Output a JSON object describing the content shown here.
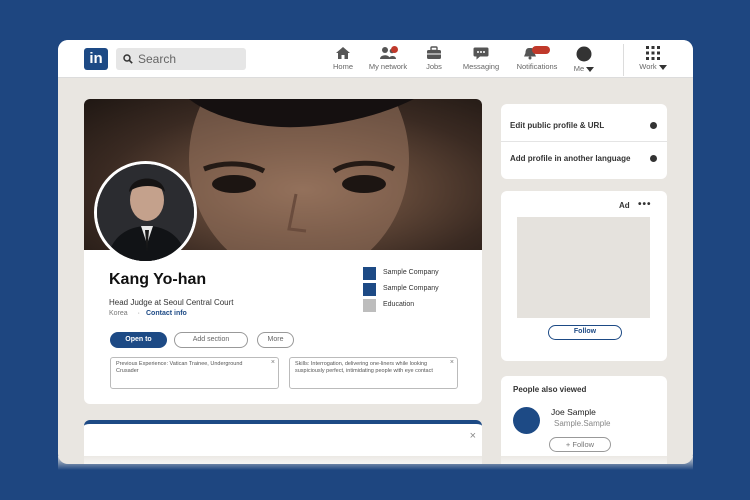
{
  "app": {
    "logo_text": "in",
    "search_placeholder": "Search",
    "accent_color": "#1d4a85",
    "notification_color": "#c0392b"
  },
  "nav": {
    "items": [
      {
        "label": "Home",
        "icon": "home-icon"
      },
      {
        "label": "My network",
        "icon": "network-icon",
        "badge": true
      },
      {
        "label": "Jobs",
        "icon": "briefcase-icon"
      },
      {
        "label": "Messaging",
        "icon": "messaging-icon"
      },
      {
        "label": "Notifications",
        "icon": "bell-icon",
        "badge": true
      },
      {
        "label": "Me",
        "icon": "avatar-icon",
        "dropdown": true
      },
      {
        "label": "Work",
        "icon": "grid-icon",
        "dropdown": true
      }
    ]
  },
  "profile": {
    "name": "Kang Yo-han",
    "headline": "Head Judge at Seoul Central Court",
    "location": "Korea",
    "separator": "·",
    "contact_info": "Contact info",
    "experience": [
      {
        "label": "Sample  Company",
        "color": "#1d4a85"
      },
      {
        "label": "Sample  Company",
        "color": "#1d4a85"
      },
      {
        "label": "Education",
        "color": "#bdbdbd"
      }
    ],
    "actions": {
      "open_to": "Open to",
      "add_section": "Add section",
      "more": "More"
    },
    "info_boxes": [
      {
        "text": "Previous Experience: Vatican Trainee, Underground Crusader"
      },
      {
        "text": "Skills: Interrogation, delivering one-liners while looking suspiciously perfect, intimidating people with eye contact"
      }
    ],
    "close_glyph": "×"
  },
  "sidebar": {
    "links": [
      {
        "label": "Edit public profile & URL"
      },
      {
        "label": "Add profile in another language"
      }
    ],
    "ad": {
      "label": "Ad",
      "more": "•••",
      "follow": "Follow"
    },
    "people_also_viewed": {
      "title": "People also viewed",
      "people": [
        {
          "name": "Joe Sample",
          "subtitle": "Sample.Sample",
          "follow": "+ Follow"
        }
      ]
    }
  }
}
